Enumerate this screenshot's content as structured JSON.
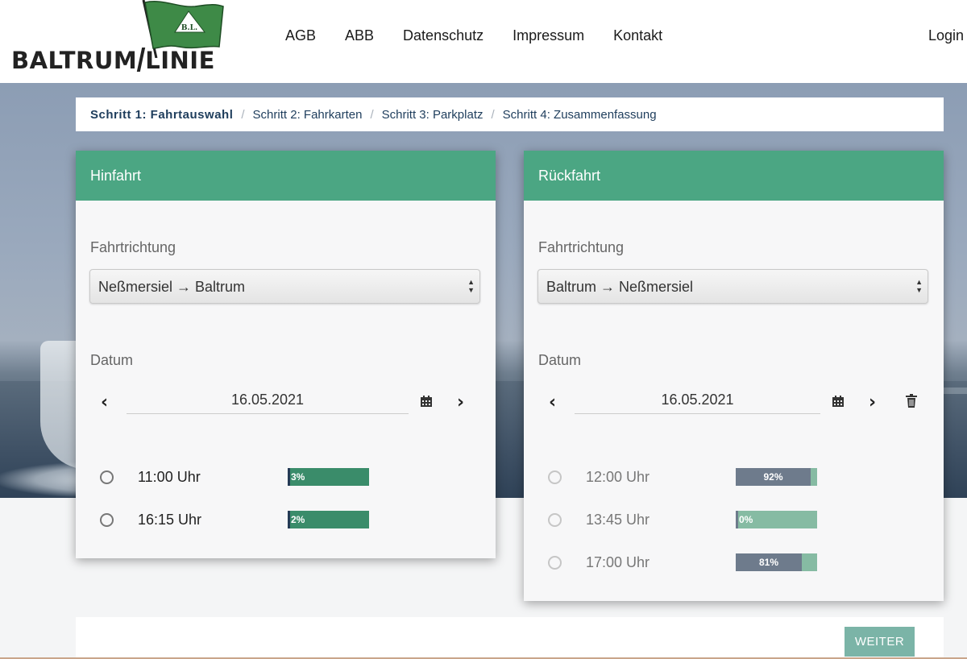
{
  "header": {
    "logo_text_left": "BALTRUM",
    "logo_text_right": "LINIE",
    "logo_flag_text": "B.L.",
    "nav": [
      "AGB",
      "ABB",
      "Datenschutz",
      "Impressum",
      "Kontakt"
    ],
    "login": "Login"
  },
  "breadcrumb": {
    "steps": [
      "Schritt 1: Fahrtauswahl",
      "Schritt 2: Fahrkarten",
      "Schritt 3: Parkplatz",
      "Schritt 4: Zusammenfassung"
    ],
    "separator": "/",
    "active_index": 0
  },
  "hinfahrt": {
    "title": "Hinfahrt",
    "direction_label": "Fahrtrichtung",
    "direction_value": "Neßmersiel → Baltrum",
    "date_label": "Datum",
    "date_value": "16.05.2021",
    "trips": [
      {
        "time": "11:00 Uhr",
        "occupancy_percent": 3,
        "label": "3%"
      },
      {
        "time": "16:15 Uhr",
        "occupancy_percent": 2,
        "label": "2%"
      }
    ]
  },
  "rueckfahrt": {
    "title": "Rückfahrt",
    "direction_label": "Fahrtrichtung",
    "direction_value": "Baltrum → Neßmersiel",
    "date_label": "Datum",
    "date_value": "16.05.2021",
    "trips": [
      {
        "time": "12:00 Uhr",
        "occupancy_percent": 92,
        "label": "92%"
      },
      {
        "time": "13:45 Uhr",
        "occupancy_percent": 0,
        "label": "0%"
      },
      {
        "time": "17:00 Uhr",
        "occupancy_percent": 81,
        "label": "81%"
      }
    ]
  },
  "footer": {
    "weiter_button": "WEITER"
  },
  "colors": {
    "accent_green": "#4ba683",
    "bar_free": "#3a8c6a",
    "bar_free_light": "#86bba3",
    "bar_used": "#6e7b8c",
    "button": "#7bb4a7",
    "link": "#1e3d5c"
  }
}
